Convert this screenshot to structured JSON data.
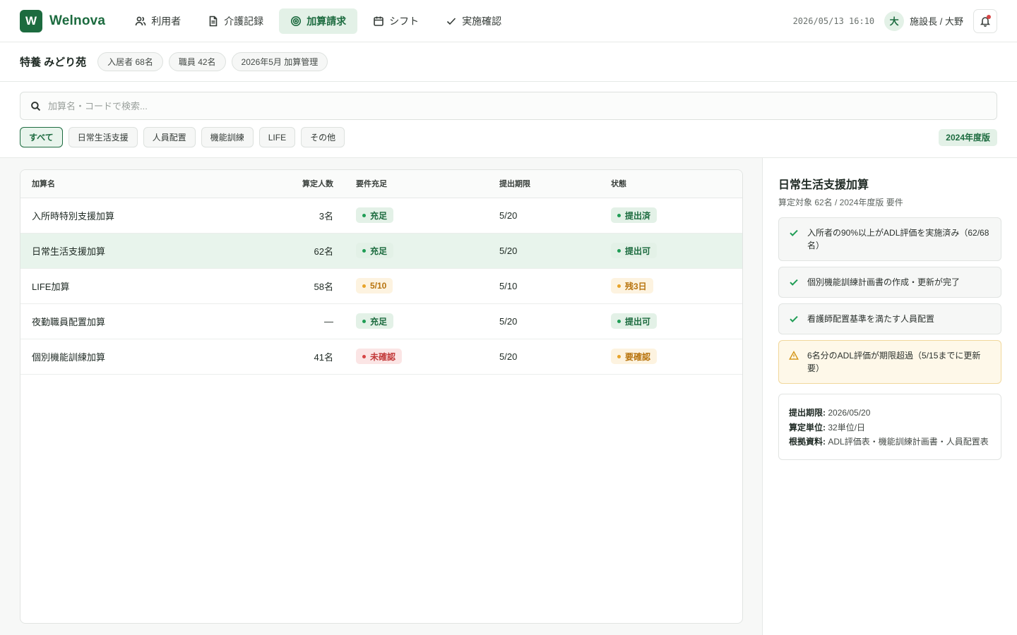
{
  "app": {
    "logo_letter": "W",
    "name": "Welnova"
  },
  "nav": [
    {
      "label": "利用者",
      "icon": "users-icon",
      "active": false
    },
    {
      "label": "介護記録",
      "icon": "document-icon",
      "active": false
    },
    {
      "label": "加算請求",
      "icon": "target-icon",
      "active": true
    },
    {
      "label": "シフト",
      "icon": "calendar-icon",
      "active": false
    },
    {
      "label": "実施確認",
      "icon": "check-icon",
      "active": false
    }
  ],
  "header": {
    "datetime": "2026/05/13 16:10",
    "avatar_initial": "大",
    "user": "施設長 / 大野"
  },
  "facility": {
    "name": "特養 みどり苑",
    "pills": [
      "入居者 68名",
      "職員 42名",
      "2026年5月 加算管理"
    ]
  },
  "search": {
    "placeholder": "加算名・コードで検索..."
  },
  "filters": [
    "すべて",
    "日常生活支援",
    "人員配置",
    "機能訓練",
    "LIFE",
    "その他"
  ],
  "active_filter": 0,
  "version_badge": "2024年度版",
  "table": {
    "headers": [
      "加算名",
      "算定人数",
      "要件充足",
      "提出期限",
      "状態"
    ],
    "rows": [
      {
        "name": "入所時特別支援加算",
        "count": "3名",
        "req": "充足",
        "req_tone": "green",
        "due": "5/20",
        "status": "提出済",
        "status_tone": "green",
        "selected": false
      },
      {
        "name": "日常生活支援加算",
        "count": "62名",
        "req": "充足",
        "req_tone": "green",
        "due": "5/20",
        "status": "提出可",
        "status_tone": "green",
        "selected": true
      },
      {
        "name": "LIFE加算",
        "count": "58名",
        "req": "5/10",
        "req_tone": "amber",
        "due": "5/10",
        "status": "残3日",
        "status_tone": "amber",
        "selected": false
      },
      {
        "name": "夜勤職員配置加算",
        "count": "—",
        "req": "充足",
        "req_tone": "green",
        "due": "5/20",
        "status": "提出可",
        "status_tone": "green",
        "selected": false
      },
      {
        "name": "個別機能訓練加算",
        "count": "41名",
        "req": "未確認",
        "req_tone": "red",
        "due": "5/20",
        "status": "要確認",
        "status_tone": "amber",
        "selected": false
      }
    ]
  },
  "detail": {
    "title": "日常生活支援加算",
    "subtitle": "算定対象 62名 / 2024年度版 要件",
    "conditions": [
      {
        "text": "入所者の90%以上がADL評価を実施済み（62/68名）",
        "type": "ok"
      },
      {
        "text": "個別機能訓練計画書の作成・更新が完了",
        "type": "ok"
      },
      {
        "text": "看護師配置基準を満たす人員配置",
        "type": "ok"
      },
      {
        "text": "6名分のADL評価が期限超過（5/15までに更新要）",
        "type": "warn"
      }
    ],
    "info": [
      {
        "label": "提出期限:",
        "value": "2026/05/20"
      },
      {
        "label": "算定単位:",
        "value": "32単位/日"
      },
      {
        "label": "根拠資料:",
        "value": "ADL評価表・機能訓練計画書・人員配置表"
      }
    ]
  },
  "colors": {
    "brand": "#1c6b3f",
    "brand_light": "#e3f1e7",
    "warn": "#b8740e",
    "danger": "#c23a3a"
  }
}
